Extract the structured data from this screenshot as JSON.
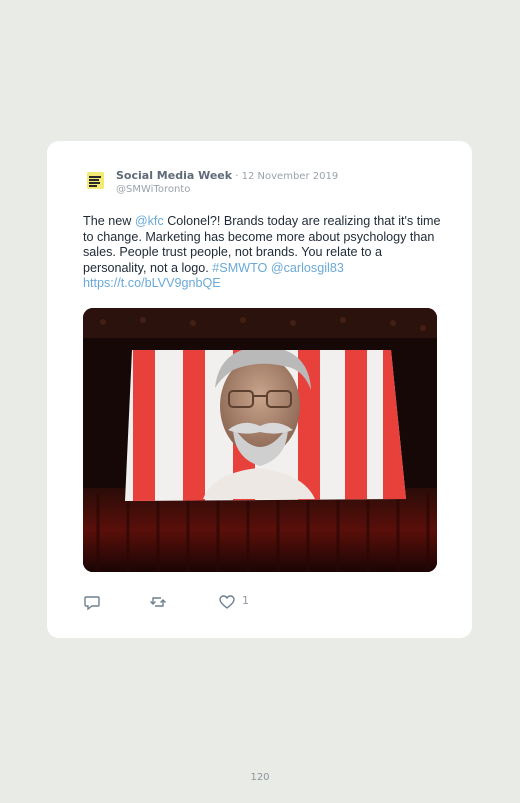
{
  "tweet": {
    "display_name": "Social Media Week",
    "separator": " · ",
    "date": "12 November 2019",
    "handle": "@SMWiToronto",
    "text_parts": [
      {
        "text": "The new ",
        "link": false
      },
      {
        "text": "@kfc",
        "link": true
      },
      {
        "text": " Colonel?! Brands today are realizing that it's time to change. Marketing has become more about psychology than sales. People trust people, not brands. You relate to a personality, not a logo. ",
        "link": false
      },
      {
        "text": "#SMWTO",
        "link": true
      },
      {
        "text": " ",
        "link": false
      },
      {
        "text": "@carlosgil83",
        "link": true
      },
      {
        "text": " ",
        "link": false
      },
      {
        "text": "https://t.co/bLVV9gnbQE",
        "link": true
      }
    ],
    "like_count": "1"
  },
  "icons": [
    "reply-icon",
    "retweet-icon",
    "like-icon"
  ],
  "colors": {
    "link": "#6aa9d8",
    "name": "#5f6b78",
    "muted": "#9aa2ab",
    "background": "#e9ebe6"
  },
  "page_number": "120"
}
